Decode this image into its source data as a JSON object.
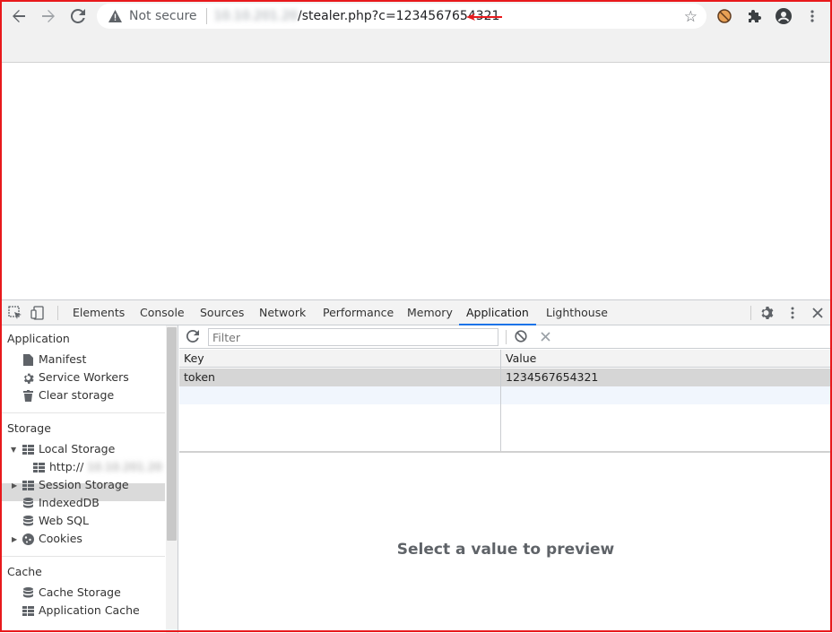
{
  "browser": {
    "url_security": "Not secure",
    "url_host": "10.10.201.20",
    "url_path": "/stealer.php?c=1234567654321"
  },
  "devtools": {
    "tabs": [
      {
        "label": "Elements"
      },
      {
        "label": "Console"
      },
      {
        "label": "Sources"
      },
      {
        "label": "Network"
      },
      {
        "label": "Performance"
      },
      {
        "label": "Memory"
      },
      {
        "label": "Application",
        "active": true
      },
      {
        "label": "Lighthouse"
      }
    ],
    "accent_color": "#1a73e8"
  },
  "sidebar": {
    "application_heading": "Application",
    "application_items": [
      {
        "label": "Manifest",
        "icon": "document-icon"
      },
      {
        "label": "Service Workers",
        "icon": "gear-icon"
      },
      {
        "label": "Clear storage",
        "icon": "trash-icon"
      }
    ],
    "storage_heading": "Storage",
    "storage_items": [
      {
        "label": "Local Storage",
        "icon": "grid-icon"
      },
      {
        "label": "http://",
        "host": "10.10.201.20",
        "icon": "grid-icon"
      },
      {
        "label": "Session Storage",
        "icon": "grid-icon"
      },
      {
        "label": "IndexedDB",
        "icon": "database-icon"
      },
      {
        "label": "Web SQL",
        "icon": "database-icon"
      },
      {
        "label": "Cookies",
        "icon": "cookie-icon"
      }
    ],
    "cache_heading": "Cache",
    "cache_items": [
      {
        "label": "Cache Storage",
        "icon": "database-icon"
      },
      {
        "label": "Application Cache",
        "icon": "grid-icon"
      }
    ]
  },
  "storage_view": {
    "filter_placeholder": "Filter",
    "columns": [
      "Key",
      "Value"
    ],
    "rows": [
      {
        "key": "token",
        "value": "1234567654321"
      }
    ],
    "preview_text": "Select a value to preview"
  },
  "colors": {
    "frame": "#e8191c",
    "selected_row": "#d6d6d6"
  }
}
